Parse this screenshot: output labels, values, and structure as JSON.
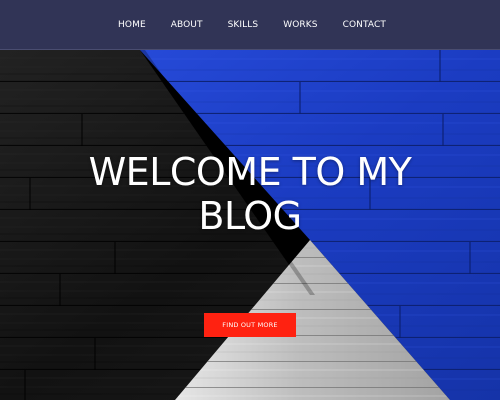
{
  "nav": {
    "items": [
      {
        "label": "HOME"
      },
      {
        "label": "ABOUT"
      },
      {
        "label": "SKILLS"
      },
      {
        "label": "WORKS"
      },
      {
        "label": "CONTACT"
      }
    ]
  },
  "hero": {
    "title_line1": "WELCOME TO MY",
    "title_line2": "BLOG",
    "cta_label": "FIND OUT MORE"
  },
  "colors": {
    "nav_bg": "#313456",
    "cta_bg": "#ff2211",
    "panel_blue": "#1c3fc4",
    "panel_black": "#141414",
    "panel_silver": "#c9c9c9"
  }
}
